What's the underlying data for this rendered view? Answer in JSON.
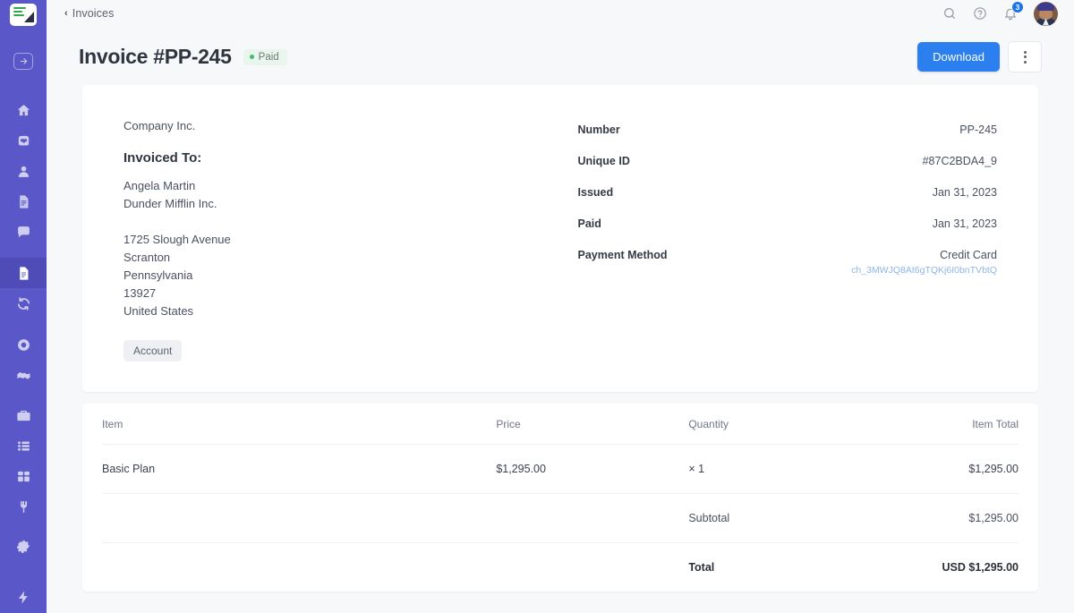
{
  "sidebar": {
    "logo_name": "paperform-logo",
    "items": [
      {
        "name": "collapse-arrow",
        "icon": "arrow-right-circle-icon"
      },
      {
        "name": "home",
        "icon": "home-icon"
      },
      {
        "name": "inbox",
        "icon": "inbox-icon"
      },
      {
        "name": "contacts",
        "icon": "user-icon"
      },
      {
        "name": "forms",
        "icon": "document-icon"
      },
      {
        "name": "messages",
        "icon": "chat-bubble-icon"
      },
      {
        "name": "invoices",
        "icon": "invoice-icon"
      },
      {
        "name": "subscriptions",
        "icon": "refresh-icon"
      },
      {
        "name": "automation",
        "icon": "target-icon"
      },
      {
        "name": "partners",
        "icon": "handshake-icon"
      },
      {
        "name": "toolbox",
        "icon": "toolbox-icon"
      },
      {
        "name": "lists",
        "icon": "list-icon"
      },
      {
        "name": "apps",
        "icon": "grid-icon"
      },
      {
        "name": "integrations",
        "icon": "plug-icon"
      },
      {
        "name": "settings",
        "icon": "gear-icon"
      },
      {
        "name": "activity",
        "icon": "bolt-icon"
      }
    ]
  },
  "topbar": {
    "back_label": "Invoices",
    "back_chevron": "‹",
    "search_name": "search-icon",
    "help_name": "help-circle-icon",
    "bell_name": "bell-icon",
    "bell_badge": "3",
    "avatar_name": "user-avatar"
  },
  "header": {
    "title": "Invoice #PP-245",
    "status": "Paid",
    "status_color": "#3fbf6b",
    "download_label": "Download",
    "download_color": "#2b7fef",
    "more_label": "more-options"
  },
  "invoice": {
    "company": "Company Inc.",
    "invoiced_to_label": "Invoiced To:",
    "customer_name": "Angela Martin",
    "customer_company": "Dunder Mifflin Inc.",
    "address": [
      "1725 Slough Avenue",
      "Scranton",
      "Pennsylvania",
      "13927",
      "United States"
    ],
    "account_tag": "Account",
    "details": [
      {
        "label": "Number",
        "value": "PP-245"
      },
      {
        "label": "Unique ID",
        "value": "#87C2BDA4_9"
      },
      {
        "label": "Issued",
        "value": "Jan 31, 2023"
      },
      {
        "label": "Paid",
        "value": "Jan 31, 2023"
      }
    ],
    "payment_method_label": "Payment Method",
    "payment_method_value": "Credit Card",
    "charge_id": "ch_3MWJQ8At6gTQKj6I0bnTVbtQ",
    "charge_id_color": "#8fb6e8"
  },
  "table": {
    "columns": {
      "item": "Item",
      "price": "Price",
      "quantity": "Quantity",
      "item_total": "Item Total"
    },
    "rows": [
      {
        "item": "Basic Plan",
        "price": "$1,295.00",
        "quantity": "× 1",
        "item_total": "$1,295.00"
      }
    ],
    "subtotal_label": "Subtotal",
    "subtotal_value": "$1,295.00",
    "total_label": "Total",
    "total_value": "USD $1,295.00"
  }
}
